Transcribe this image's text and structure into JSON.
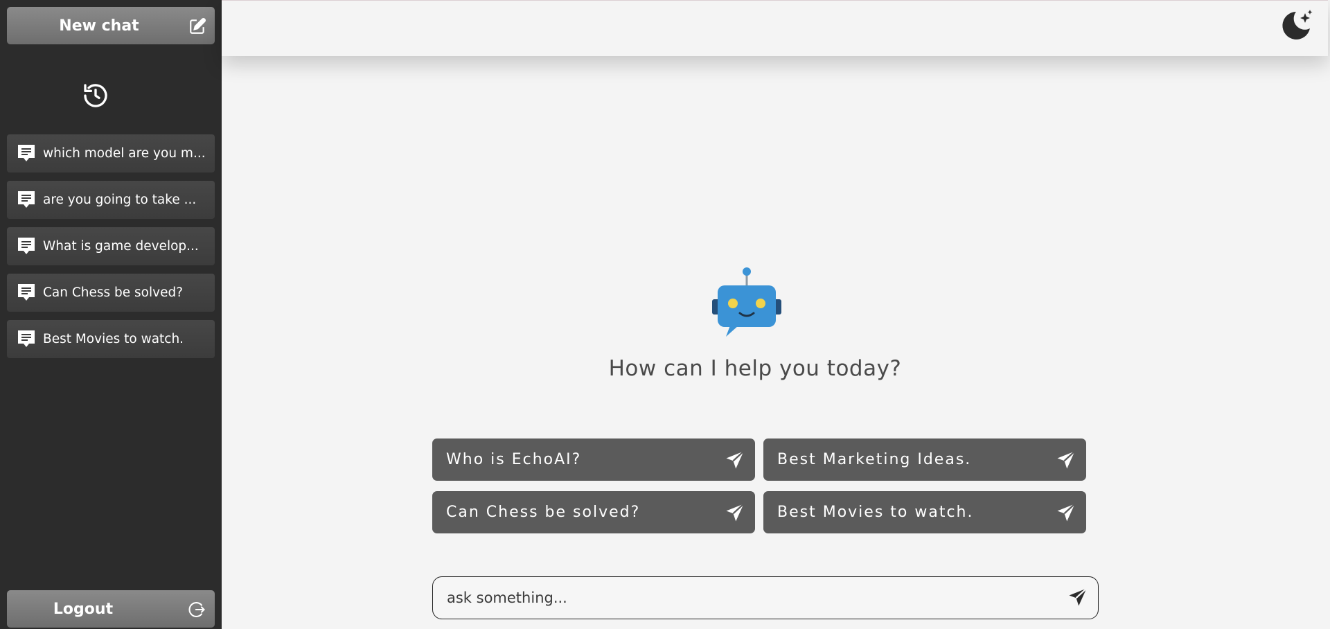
{
  "sidebar": {
    "new_chat_label": "New chat",
    "history": [
      {
        "label": "which model are you m..."
      },
      {
        "label": "are you going to take ..."
      },
      {
        "label": "What is game develop..."
      },
      {
        "label": "Can Chess be solved?"
      },
      {
        "label": "Best Movies to watch."
      }
    ],
    "logout_label": "Logout"
  },
  "main": {
    "greeting": "How can I help you today?",
    "suggestions": [
      {
        "label": "Who is EchoAI?"
      },
      {
        "label": "Best Marketing Ideas."
      },
      {
        "label": "Can Chess be solved?"
      },
      {
        "label": "Best Movies to watch."
      }
    ],
    "input": {
      "placeholder": "ask something..."
    }
  },
  "icons": {
    "new_chat": "edit-icon",
    "history": "history-icon",
    "chat_item": "chat-bubble-icon",
    "logout": "logout-icon",
    "theme": "moon-stars-icon",
    "bot": "robot-icon",
    "send": "send-icon"
  },
  "colors": {
    "sidebar_bg": "#2c2c2c",
    "main_bg": "#f4f4f4",
    "suggestion_bg": "#5b5b5b",
    "bot_blue": "#3b93d6",
    "bot_eyes": "#f2d34c"
  }
}
